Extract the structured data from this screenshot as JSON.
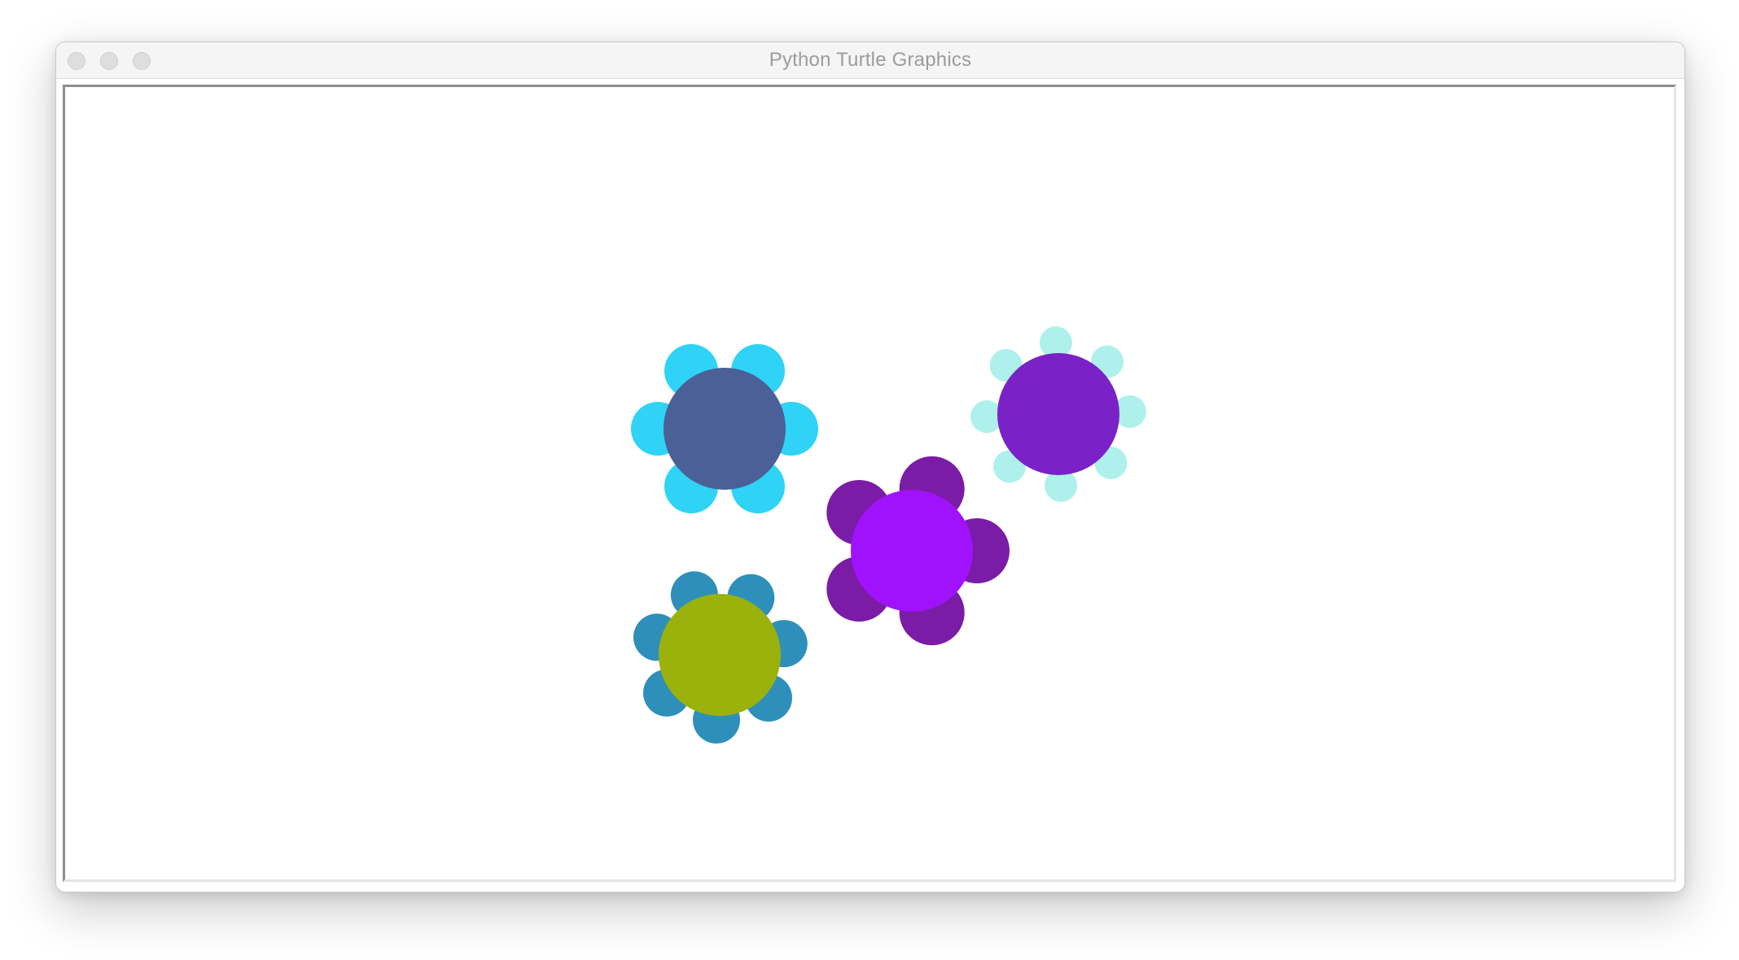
{
  "window": {
    "title": "Python Turtle Graphics"
  },
  "colors": {
    "canvas_background": "#ffffff",
    "titlebar_background": "#f5f5f5",
    "title_text": "#9c9c9c"
  },
  "flowers": [
    {
      "name": "flower-top-left",
      "petal_color": "#2ed3f6",
      "center_color": "#4a6096",
      "petal_count": 6
    },
    {
      "name": "flower-top-right",
      "petal_color": "#aef0ec",
      "center_color": "#7a22c7",
      "petal_count": 8
    },
    {
      "name": "flower-middle",
      "petal_color": "#7a1ca6",
      "center_color": "#a012fc",
      "petal_count": 5
    },
    {
      "name": "flower-bottom-left",
      "petal_color": "#2e8fba",
      "center_color": "#9bb20d",
      "petal_count": 7
    }
  ]
}
